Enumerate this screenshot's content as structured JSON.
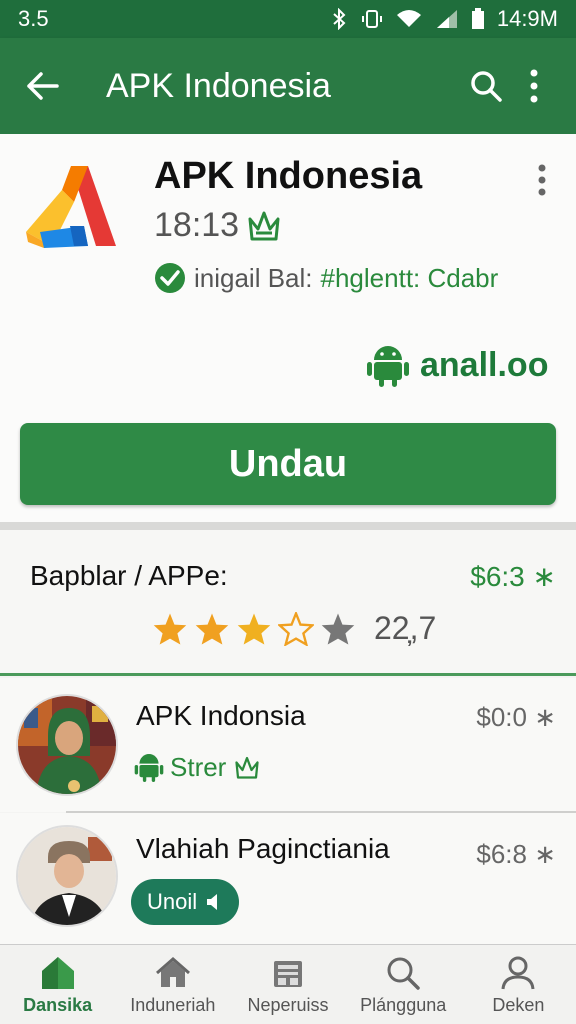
{
  "status_bar": {
    "time_left": "3.5",
    "time_right": "14:9M"
  },
  "app_bar": {
    "title": "APK Indonesia"
  },
  "app": {
    "title": "APK Indonesia",
    "time": "18:13",
    "verified_gray": "inigail Bal:",
    "verified_green": "#hglentt: Cdabr",
    "platform_label": "anall.oo",
    "install_label": "Undau"
  },
  "summary": {
    "title": "Bapblar / APPe:",
    "price": "$6:3 ∗",
    "rating": 3,
    "rating_count": "22̦,7"
  },
  "list": [
    {
      "title": "APK Indonsia",
      "price": "$0:0 ∗",
      "tag": "Strer"
    },
    {
      "title": "Vlahiah Paginctiania",
      "price": "$6:8 ∗",
      "pill": "Unoil"
    }
  ],
  "bottom_nav": [
    {
      "label": "Dansika",
      "icon": "home-icon",
      "active": true
    },
    {
      "label": "Induneriah",
      "icon": "house-icon",
      "active": false
    },
    {
      "label": "Neperuiss",
      "icon": "store-icon",
      "active": false
    },
    {
      "label": "Plángguna",
      "icon": "search-icon",
      "active": false
    },
    {
      "label": "Deken",
      "icon": "person-icon",
      "active": false
    }
  ],
  "colors": {
    "primary": "#2a7a44",
    "accent_green": "#2a8a3c",
    "star": "#f0a020"
  }
}
